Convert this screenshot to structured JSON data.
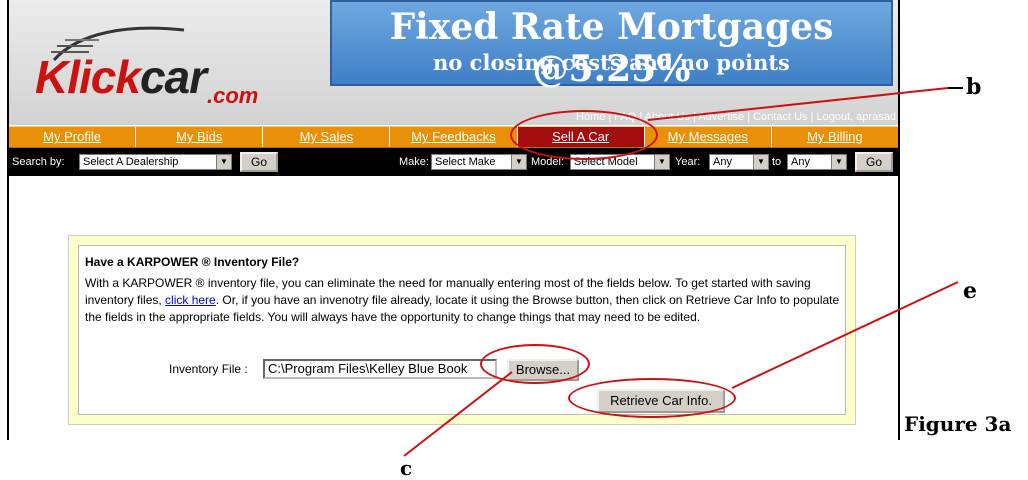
{
  "logo": {
    "main": "Klick",
    "car": "car",
    "suffix": ".com"
  },
  "banner": {
    "headline": "Fixed Rate Mortgages @5.25%",
    "subline": "no closing costs and no points"
  },
  "top_links": {
    "text": "Home | FAQ | About Us | Advertise | Contact Us | Logout, aprasad"
  },
  "tabs": [
    {
      "label": "My Profile"
    },
    {
      "label": "My Bids"
    },
    {
      "label": "My Sales"
    },
    {
      "label": "My Feedbacks"
    },
    {
      "label": "Sell A Car",
      "active": true
    },
    {
      "label": "My Messages"
    },
    {
      "label": "My Billing"
    }
  ],
  "search": {
    "search_by_label": "Search by:",
    "dealership_value": "Select A Dealership",
    "go_label": "Go",
    "make_label": "Make:",
    "make_value": "Select Make",
    "model_label": "Model:",
    "model_value": "Select Model",
    "year_label": "Year:",
    "year_from": "Any",
    "to_label": "to",
    "year_to": "Any",
    "go2_label": "Go"
  },
  "panel": {
    "title": "Have a KARPOWER ® Inventory File?",
    "body_part1": "With a KARPOWER ® inventory file, you can eliminate the need for manually entering most of the fields below. To get started with saving inventory files, ",
    "link_text": "click here",
    "body_part2": ". Or, if you have an invenotry file already, locate it using the Browse button, then click on Retrieve Car Info to populate the fields in the appropriate fields. You will always have the opportunity to change things that may need to be edited.",
    "inventory_label": "Inventory File :",
    "inventory_value": "C:\\Program Files\\Kelley Blue Book",
    "browse_label": "Browse...",
    "retrieve_label": "Retrieve Car Info."
  },
  "annotations": {
    "b": "b",
    "c": "c",
    "e": "e",
    "figure": "Figure 3a"
  },
  "colors": {
    "tab_bg": "#e98f08",
    "tab_active": "#a30d0d",
    "highlight_ring": "#cc1111",
    "panel_bg": "#ffffcc"
  }
}
